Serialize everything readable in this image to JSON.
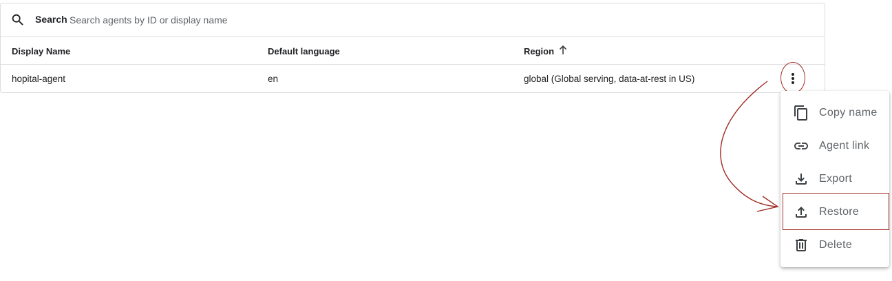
{
  "search": {
    "label": "Search",
    "placeholder": "Search agents by ID or display name",
    "value": ""
  },
  "table": {
    "columns": [
      "Display Name",
      "Default language",
      "Region"
    ],
    "sort_direction": "ascending",
    "rows": [
      [
        "hopital-agent",
        "en",
        "global (Global serving, data-at-rest in US)"
      ]
    ]
  },
  "menu": {
    "items": [
      {
        "label": "Copy name",
        "icon": "copy-icon"
      },
      {
        "label": "Agent link",
        "icon": "link-icon"
      },
      {
        "label": "Export",
        "icon": "download-icon"
      },
      {
        "label": "Restore",
        "icon": "upload-icon"
      },
      {
        "label": "Delete",
        "icon": "trash-icon"
      }
    ]
  },
  "colors": {
    "annotation": "#9f2a22",
    "icon": "#3c4043"
  }
}
